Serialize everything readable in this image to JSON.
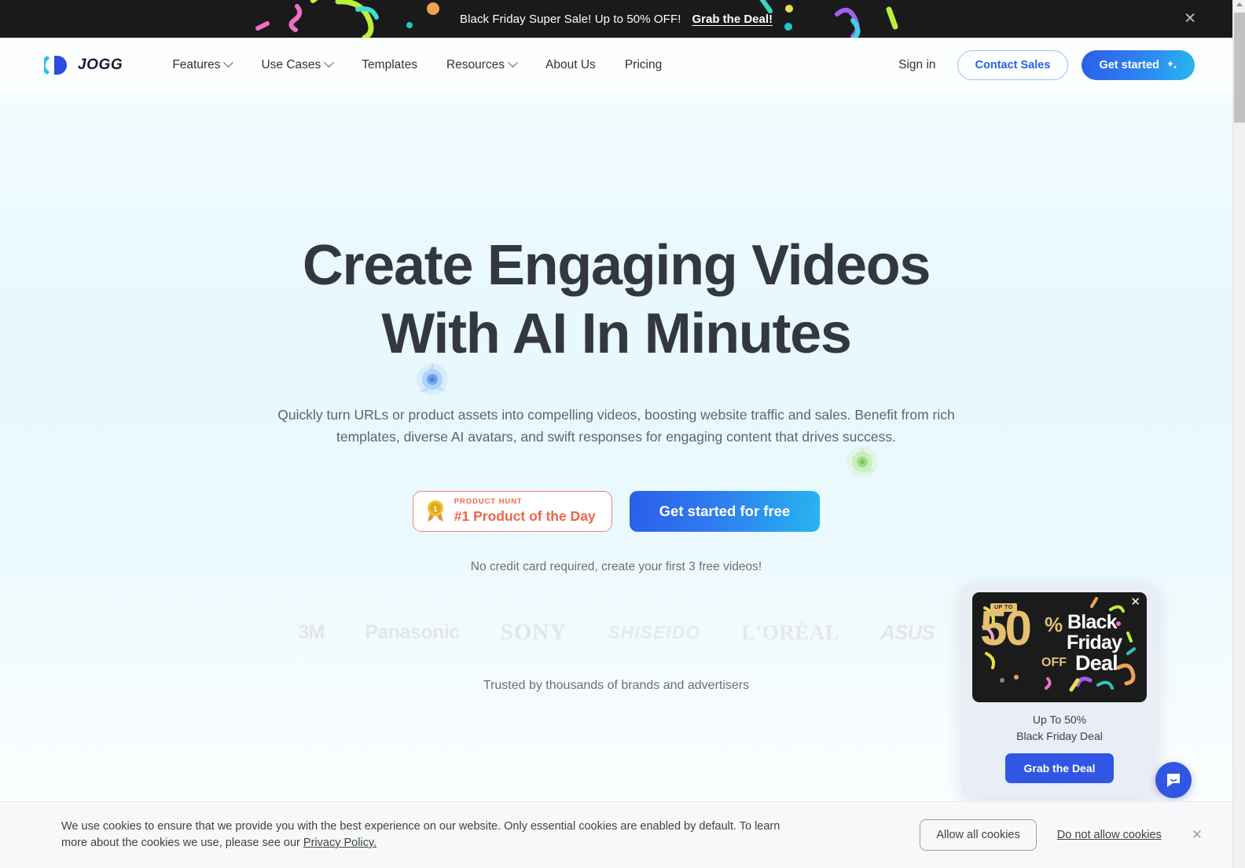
{
  "promo_banner": {
    "text": "Black Friday Super Sale! Up to 50% OFF!",
    "link_label": "Grab the Deal!",
    "close_icon": "close-icon"
  },
  "header": {
    "logo_text": "JOGG",
    "logo_icon": "jogg-logo-icon",
    "nav": [
      {
        "label": "Features",
        "has_chevron": true
      },
      {
        "label": "Use Cases",
        "has_chevron": true
      },
      {
        "label": "Templates",
        "has_chevron": false
      },
      {
        "label": "Resources",
        "has_chevron": true
      },
      {
        "label": "About Us",
        "has_chevron": false
      },
      {
        "label": "Pricing",
        "has_chevron": false
      }
    ],
    "sign_in": "Sign in",
    "contact_sales": "Contact Sales",
    "get_started": "Get started",
    "get_started_icon": "sparkle-icon"
  },
  "hero": {
    "headline_line1": "Create Engaging Videos",
    "headline_line2": "With AI In Minutes",
    "subheadline": "Quickly turn URLs or product assets into compelling videos, boosting website traffic and sales. Benefit from rich templates, diverse AI avatars, and swift responses for engaging content that drives success.",
    "product_hunt": {
      "kicker": "PRODUCT HUNT",
      "title": "#1 Product of the Day",
      "medal_icon": "product-hunt-medal-icon",
      "rank": "1"
    },
    "cta_label": "Get started for free",
    "no_credit_card": "No credit card required, create your first 3 free videos!",
    "brands": [
      "3M",
      "Panasonic",
      "SONY",
      "SHISEIDO",
      "L'ORÉAL",
      "ASUS"
    ],
    "trusted_text": "Trusted by thousands of brands and advertisers"
  },
  "black_friday_popup": {
    "close_icon": "close-icon",
    "image": {
      "up_to": "UP TO",
      "number": "50",
      "percent": "%",
      "off": "OFF",
      "word1": "Black",
      "word2": "Friday",
      "word3": "Deal"
    },
    "line1": "Up To 50%",
    "line2": "Black Friday Deal",
    "button_label": "Grab the Deal"
  },
  "chat_widget": {
    "icon": "chat-bubble-icon"
  },
  "cookie_banner": {
    "text_part1": "We use cookies to ensure that we provide you with the best experience on our website. Only essential cookies are enabled by default. To learn more about the cookies we use, please see our ",
    "privacy_link": "Privacy Policy.",
    "allow_label": "Allow all cookies",
    "deny_label": "Do not allow cookies",
    "close_icon": "close-icon"
  },
  "colors": {
    "accent_blue": "#2563eb",
    "accent_cyan": "#28b6f0",
    "product_hunt_red": "#f1634a",
    "banner_black": "#1a1a1a",
    "gold": "#e7bf72"
  }
}
